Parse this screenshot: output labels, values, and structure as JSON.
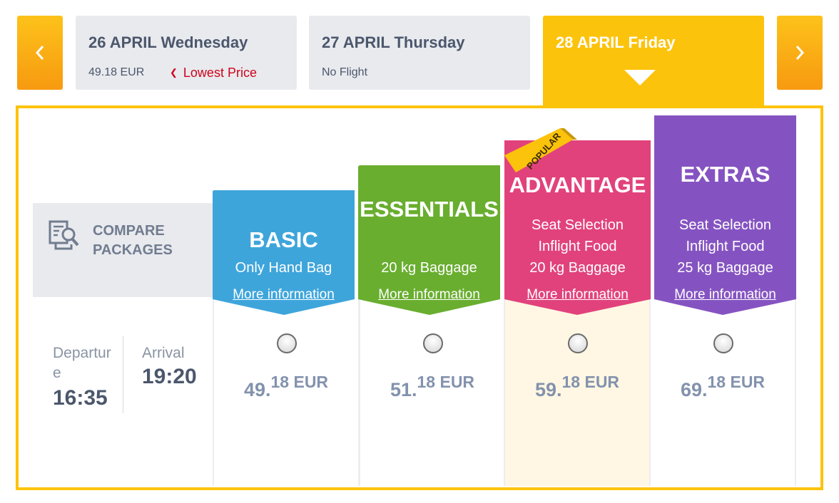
{
  "dates": {
    "prev_icon": "chevron-left-icon",
    "next_icon": "chevron-right-icon",
    "tabs": [
      {
        "title": "26 APRIL Wednesday",
        "price": "49.18 EUR",
        "note": "Lowest Price"
      },
      {
        "title": "27 APRIL Thursday",
        "status": "No Flight"
      },
      {
        "title": "28 APRIL Friday",
        "selected": true
      }
    ]
  },
  "compare": {
    "icon": "compare-document-search-icon",
    "line1": "COMPARE",
    "line2": "PACKAGES"
  },
  "flight": {
    "departure_label_1": "Departur",
    "departure_label_2": "e",
    "departure_time": "16:35",
    "arrival_label": "Arrival",
    "arrival_time": "19:20"
  },
  "packages": [
    {
      "name": "BASIC",
      "features": [
        "Only Hand Bag"
      ],
      "more": "More information",
      "price_int": "49.",
      "price_dec": "18 EUR",
      "color": "#3ea5db"
    },
    {
      "name": "ESSENTIALS",
      "features": [
        "20 kg Baggage"
      ],
      "more": "More information",
      "price_int": "51.",
      "price_dec": "18 EUR",
      "color": "#69ae2f"
    },
    {
      "name": "ADVANTAGE",
      "features": [
        "Seat Selection",
        "Inflight Food",
        "20 kg Baggage"
      ],
      "more": "More information",
      "price_int": "59.",
      "price_dec": "18 EUR",
      "color": "#e1427c",
      "badge": "POPULAR"
    },
    {
      "name": "EXTRAS",
      "features": [
        "Seat Selection",
        "Inflight Food",
        "25 kg Baggage"
      ],
      "more": "More information",
      "price_int": "69.",
      "price_dec": "18 EUR",
      "color": "#8553c1"
    }
  ],
  "accent_color": "#fcc30c"
}
